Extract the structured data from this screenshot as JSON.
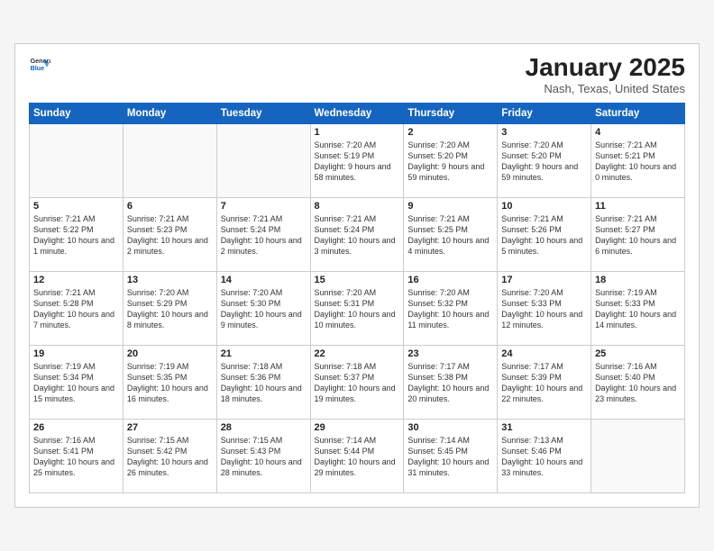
{
  "header": {
    "logo": {
      "general": "General",
      "blue": "Blue"
    },
    "title": "January 2025",
    "location": "Nash, Texas, United States"
  },
  "weekdays": [
    "Sunday",
    "Monday",
    "Tuesday",
    "Wednesday",
    "Thursday",
    "Friday",
    "Saturday"
  ],
  "weeks": [
    [
      {
        "day": "",
        "info": ""
      },
      {
        "day": "",
        "info": ""
      },
      {
        "day": "",
        "info": ""
      },
      {
        "day": "1",
        "info": "Sunrise: 7:20 AM\nSunset: 5:19 PM\nDaylight: 9 hours and 58 minutes."
      },
      {
        "day": "2",
        "info": "Sunrise: 7:20 AM\nSunset: 5:20 PM\nDaylight: 9 hours and 59 minutes."
      },
      {
        "day": "3",
        "info": "Sunrise: 7:20 AM\nSunset: 5:20 PM\nDaylight: 9 hours and 59 minutes."
      },
      {
        "day": "4",
        "info": "Sunrise: 7:21 AM\nSunset: 5:21 PM\nDaylight: 10 hours and 0 minutes."
      }
    ],
    [
      {
        "day": "5",
        "info": "Sunrise: 7:21 AM\nSunset: 5:22 PM\nDaylight: 10 hours and 1 minute."
      },
      {
        "day": "6",
        "info": "Sunrise: 7:21 AM\nSunset: 5:23 PM\nDaylight: 10 hours and 2 minutes."
      },
      {
        "day": "7",
        "info": "Sunrise: 7:21 AM\nSunset: 5:24 PM\nDaylight: 10 hours and 2 minutes."
      },
      {
        "day": "8",
        "info": "Sunrise: 7:21 AM\nSunset: 5:24 PM\nDaylight: 10 hours and 3 minutes."
      },
      {
        "day": "9",
        "info": "Sunrise: 7:21 AM\nSunset: 5:25 PM\nDaylight: 10 hours and 4 minutes."
      },
      {
        "day": "10",
        "info": "Sunrise: 7:21 AM\nSunset: 5:26 PM\nDaylight: 10 hours and 5 minutes."
      },
      {
        "day": "11",
        "info": "Sunrise: 7:21 AM\nSunset: 5:27 PM\nDaylight: 10 hours and 6 minutes."
      }
    ],
    [
      {
        "day": "12",
        "info": "Sunrise: 7:21 AM\nSunset: 5:28 PM\nDaylight: 10 hours and 7 minutes."
      },
      {
        "day": "13",
        "info": "Sunrise: 7:20 AM\nSunset: 5:29 PM\nDaylight: 10 hours and 8 minutes."
      },
      {
        "day": "14",
        "info": "Sunrise: 7:20 AM\nSunset: 5:30 PM\nDaylight: 10 hours and 9 minutes."
      },
      {
        "day": "15",
        "info": "Sunrise: 7:20 AM\nSunset: 5:31 PM\nDaylight: 10 hours and 10 minutes."
      },
      {
        "day": "16",
        "info": "Sunrise: 7:20 AM\nSunset: 5:32 PM\nDaylight: 10 hours and 11 minutes."
      },
      {
        "day": "17",
        "info": "Sunrise: 7:20 AM\nSunset: 5:33 PM\nDaylight: 10 hours and 12 minutes."
      },
      {
        "day": "18",
        "info": "Sunrise: 7:19 AM\nSunset: 5:33 PM\nDaylight: 10 hours and 14 minutes."
      }
    ],
    [
      {
        "day": "19",
        "info": "Sunrise: 7:19 AM\nSunset: 5:34 PM\nDaylight: 10 hours and 15 minutes."
      },
      {
        "day": "20",
        "info": "Sunrise: 7:19 AM\nSunset: 5:35 PM\nDaylight: 10 hours and 16 minutes."
      },
      {
        "day": "21",
        "info": "Sunrise: 7:18 AM\nSunset: 5:36 PM\nDaylight: 10 hours and 18 minutes."
      },
      {
        "day": "22",
        "info": "Sunrise: 7:18 AM\nSunset: 5:37 PM\nDaylight: 10 hours and 19 minutes."
      },
      {
        "day": "23",
        "info": "Sunrise: 7:17 AM\nSunset: 5:38 PM\nDaylight: 10 hours and 20 minutes."
      },
      {
        "day": "24",
        "info": "Sunrise: 7:17 AM\nSunset: 5:39 PM\nDaylight: 10 hours and 22 minutes."
      },
      {
        "day": "25",
        "info": "Sunrise: 7:16 AM\nSunset: 5:40 PM\nDaylight: 10 hours and 23 minutes."
      }
    ],
    [
      {
        "day": "26",
        "info": "Sunrise: 7:16 AM\nSunset: 5:41 PM\nDaylight: 10 hours and 25 minutes."
      },
      {
        "day": "27",
        "info": "Sunrise: 7:15 AM\nSunset: 5:42 PM\nDaylight: 10 hours and 26 minutes."
      },
      {
        "day": "28",
        "info": "Sunrise: 7:15 AM\nSunset: 5:43 PM\nDaylight: 10 hours and 28 minutes."
      },
      {
        "day": "29",
        "info": "Sunrise: 7:14 AM\nSunset: 5:44 PM\nDaylight: 10 hours and 29 minutes."
      },
      {
        "day": "30",
        "info": "Sunrise: 7:14 AM\nSunset: 5:45 PM\nDaylight: 10 hours and 31 minutes."
      },
      {
        "day": "31",
        "info": "Sunrise: 7:13 AM\nSunset: 5:46 PM\nDaylight: 10 hours and 33 minutes."
      },
      {
        "day": "",
        "info": ""
      }
    ]
  ]
}
